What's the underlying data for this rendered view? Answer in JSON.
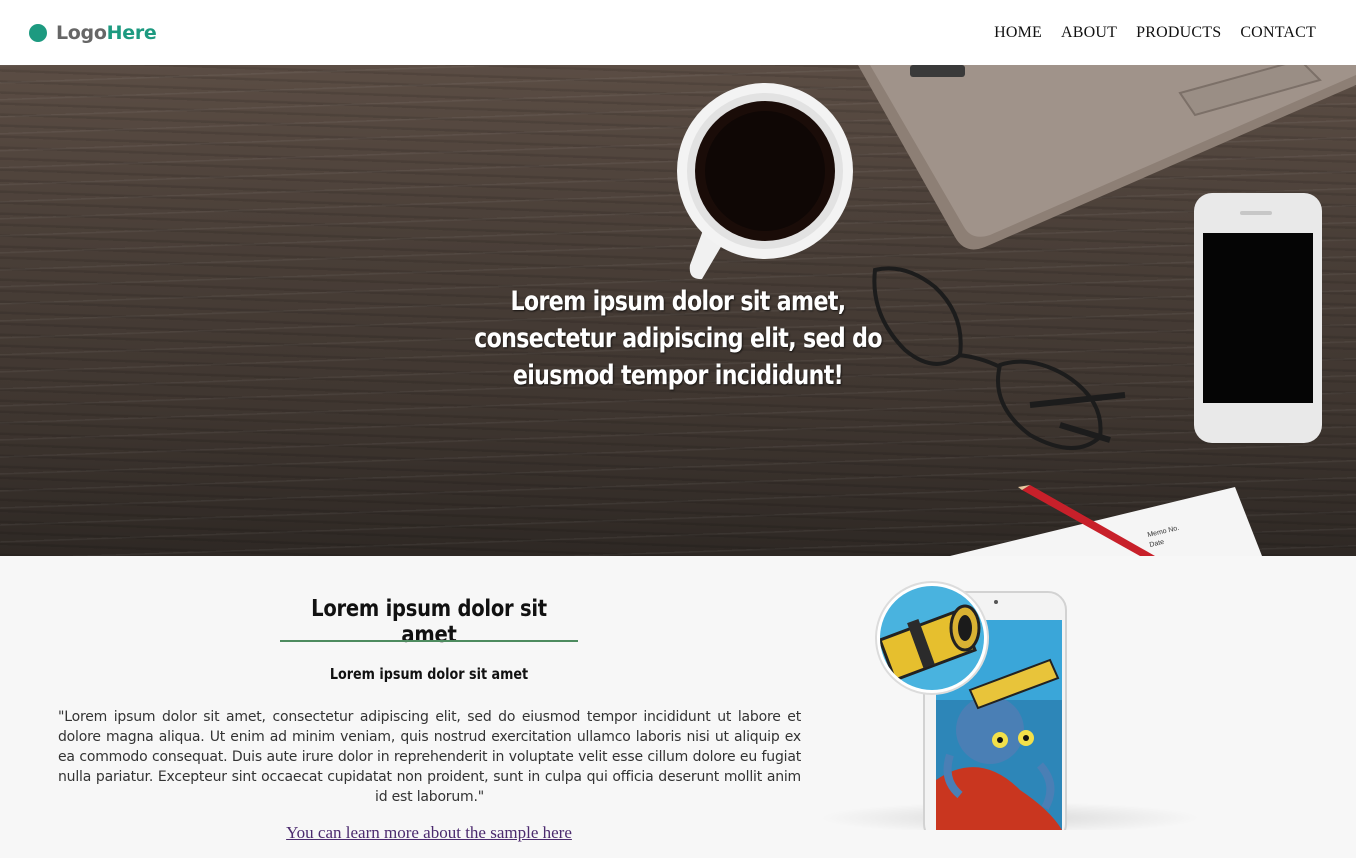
{
  "header": {
    "logo_prefix": "Logo",
    "logo_accent": "Here",
    "nav": [
      "HOME",
      "ABOUT",
      "PRODUCTS",
      "CONTACT"
    ]
  },
  "hero": {
    "title": "Lorem ipsum dolor sit amet, consectetur adipiscing elit, sed do eiusmod tempor incididunt!"
  },
  "content": {
    "title": "Lorem ipsum dolor sit amet",
    "subtitle": "Lorem ipsum dolor sit amet",
    "quote": "\"Lorem ipsum dolor sit amet, consectetur adipiscing elit, sed do eiusmod tempor incididunt ut labore et dolore magna aliqua. Ut enim ad minim veniam, quis nostrud exercitation ullamco laboris nisi ut aliquip ex ea commodo consequat. Duis aute irure dolor in reprehenderit in voluptate velit esse cillum dolore eu fugiat nulla pariatur. Excepteur sint occaecat cupidatat non proident, sunt in culpa qui officia deserunt mollit anim id est laborum.\"",
    "link_text": "You can learn more about the sample here"
  },
  "colors": {
    "accent": "#1d9a80",
    "rule": "#4d8b5f",
    "link": "#4b2a6e"
  }
}
